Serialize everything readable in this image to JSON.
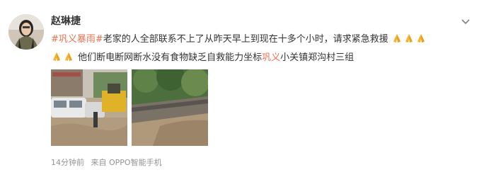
{
  "post": {
    "username": "赵琳捷",
    "line1": {
      "hashtag": "#巩义暴雨#",
      "text": "老家的人全部联系不上了从昨天早上到现在十多个小时，请求紧急救援"
    },
    "line2": {
      "text_before": "他们断电断网断水没有食物缺乏自救能力坐标",
      "location": "巩义",
      "text_after": "小关镇郑沟村三组"
    },
    "time": "14分钟前",
    "source": "来自 OPPO智能手机"
  },
  "icons": {
    "menu": "chevron-down-icon",
    "emoji": "praying-hands-emoji"
  },
  "colors": {
    "link": "#eb7350",
    "meta": "#939393"
  }
}
